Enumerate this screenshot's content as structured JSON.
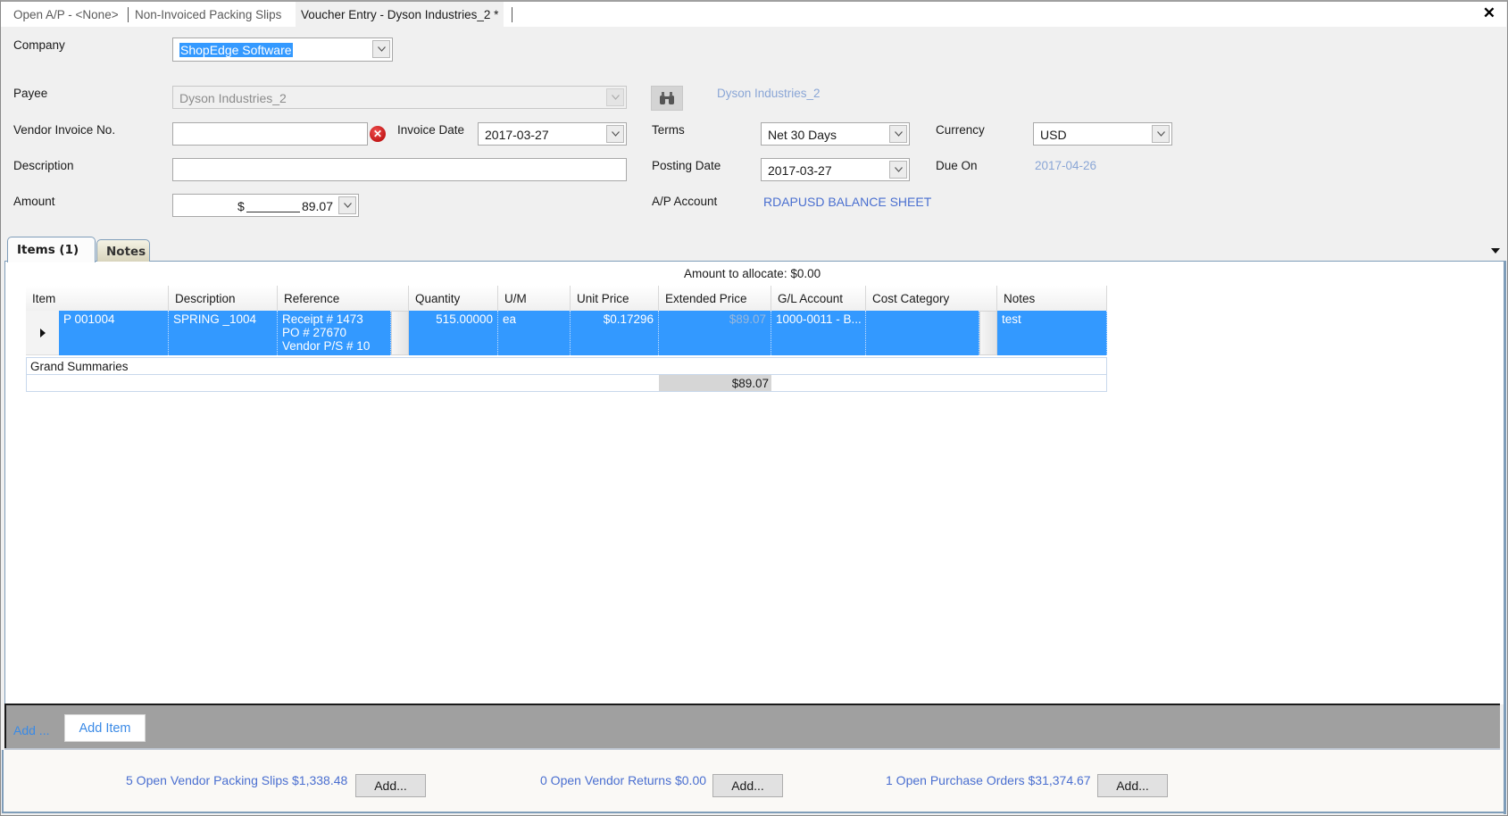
{
  "tabs": [
    {
      "label": "Open A/P - <None>",
      "active": false
    },
    {
      "label": "Non-Invoiced Packing Slips",
      "active": false
    },
    {
      "label": "Voucher Entry - Dyson Industries_2 *",
      "active": true
    }
  ],
  "close_icon": "close-icon",
  "form": {
    "company": {
      "label": "Company",
      "value": "ShopEdge Software"
    },
    "payee": {
      "label": "Payee",
      "value": "Dyson Industries_2",
      "link": "Dyson Industries_2"
    },
    "vendor_invoice": {
      "label": "Vendor Invoice No.",
      "value": ""
    },
    "invoice_date": {
      "label": "Invoice Date",
      "value": "2017-03-27"
    },
    "terms": {
      "label": "Terms",
      "value": "Net 30 Days"
    },
    "currency": {
      "label": "Currency",
      "value": "USD"
    },
    "description": {
      "label": "Description",
      "value": ""
    },
    "posting_date": {
      "label": "Posting Date",
      "value": "2017-03-27"
    },
    "due_on": {
      "label": "Due On",
      "value": "2017-04-26"
    },
    "amount": {
      "label": "Amount",
      "currency_symbol": "$",
      "value": "89.07"
    },
    "ap_account": {
      "label": "A/P Account",
      "value": "RDAPUSD BALANCE SHEET"
    }
  },
  "panel_tabs": [
    {
      "label": "Items (1)",
      "active": true
    },
    {
      "label": "Notes",
      "active": false
    }
  ],
  "grid": {
    "amount_to_allocate": "Amount to allocate: $0.00",
    "columns": [
      "Item",
      "Description",
      "Reference",
      "Quantity",
      "U/M",
      "Unit Price",
      "Extended Price",
      "G/L Account",
      "Cost Category",
      "Notes"
    ],
    "rows": [
      {
        "item": "P 001004",
        "description": "SPRING _1004",
        "reference": [
          "Receipt # 1473",
          "PO # 27670",
          "Vendor P/S # 10"
        ],
        "quantity": "515.00000",
        "um": "ea",
        "unit_price": "$0.17296",
        "extended_price": "$89.07",
        "gl_account": "1000-0011 - B...",
        "cost_category": "",
        "notes": "test"
      }
    ],
    "grand_summaries_label": "Grand Summaries",
    "grand_total": "$89.07"
  },
  "bottom_bar": {
    "add_label": "Add ...",
    "add_item_label": "Add Item"
  },
  "footer": {
    "packing_slips": "5 Open Vendor Packing Slips $1,338.48",
    "vendor_returns": "0 Open Vendor Returns $0.00",
    "purchase_orders": "1 Open Purchase Orders $31,374.67",
    "add_button_label": "Add..."
  },
  "colors": {
    "selection": "#3399ff",
    "link": "#4a6fd0",
    "link_dim": "#8aa6d6",
    "bottom_bar": "#a0a0a0"
  }
}
